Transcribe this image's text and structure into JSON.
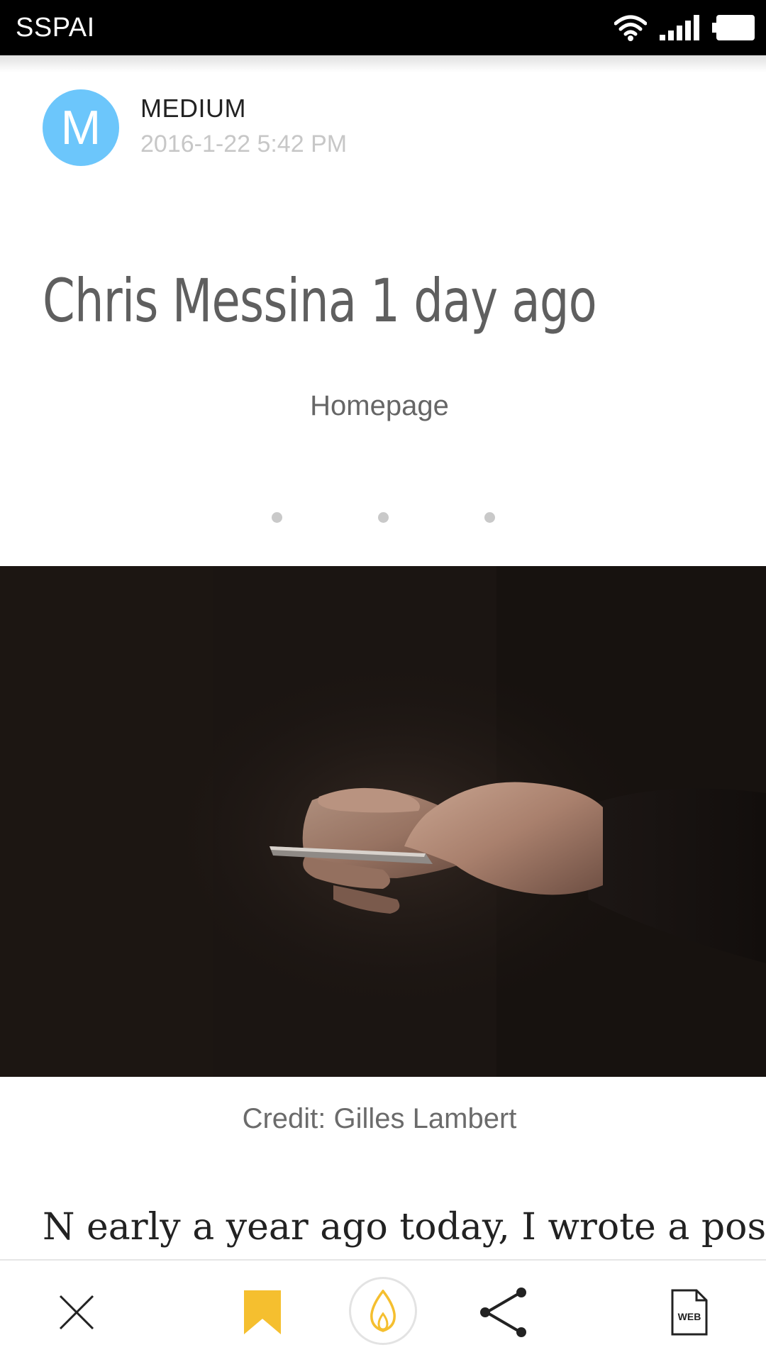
{
  "status_bar": {
    "carrier": "SSPAI",
    "icons": [
      "wifi-icon",
      "signal-icon",
      "battery-icon"
    ]
  },
  "source": {
    "avatar_letter": "M",
    "avatar_color": "#6cc6fb",
    "name": "MEDIUM",
    "date": "2016-1-22 5:42 PM"
  },
  "article": {
    "title": "Chris Messina 1 day ago",
    "subtitle": "Homepage",
    "image_credit": "Credit: Gilles Lambert",
    "first_line": "N early a year ago today, I wrote a post"
  },
  "toolbar": {
    "icons": [
      "close-icon",
      "bookmark-icon",
      "flame-icon",
      "share-icon",
      "web-document-icon"
    ],
    "web_icon_label": "WEB",
    "accent_color": "#f5bf2f"
  }
}
